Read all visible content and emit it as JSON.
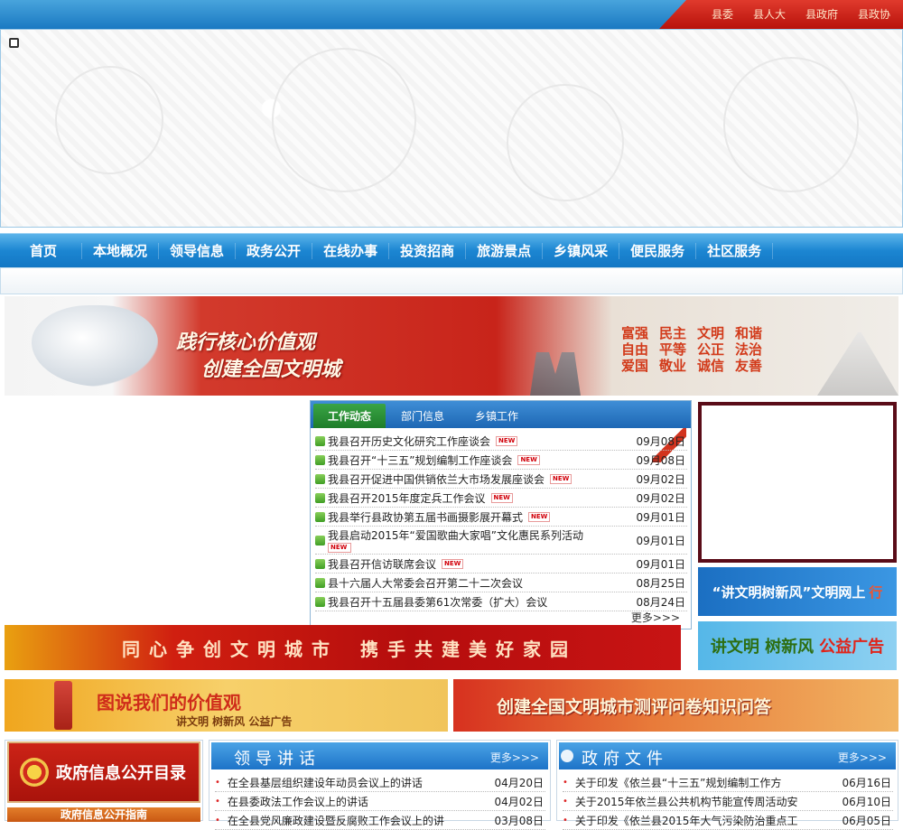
{
  "top_links": [
    "县委",
    "县人大",
    "县政府",
    "县政协"
  ],
  "nav": [
    "首页",
    "本地概况",
    "领导信息",
    "政务公开",
    "在线办事",
    "投资招商",
    "旅游景点",
    "乡镇风采",
    "便民服务",
    "社区服务"
  ],
  "red_banner": {
    "slogan_line1": "践行核心价值观",
    "slogan_line2": "创建全国文明城",
    "values": [
      "富强",
      "民主",
      "文明",
      "和谐",
      "自由",
      "平等",
      "公正",
      "法治",
      "爱国",
      "敬业",
      "诚信",
      "友善"
    ]
  },
  "news": {
    "tabs": [
      "工作动态",
      "部门信息",
      "乡镇工作"
    ],
    "new_tag": "NEW",
    "more": "更多>>>",
    "items": [
      {
        "title": "我县召开历史文化研究工作座谈会",
        "date": "09月08日"
      },
      {
        "title": "我县召开“十三五”规划编制工作座谈会",
        "date": "09月08日"
      },
      {
        "title": "我县召开促进中国供销依兰大市场发展座谈会",
        "date": "09月02日"
      },
      {
        "title": "我县召开2015年度定兵工作会议",
        "date": "09月02日"
      },
      {
        "title": "我县举行县政协第五届书画摄影展开幕式",
        "date": "09月01日"
      },
      {
        "title": "我县启动2015年“爱国歌曲大家唱”文化惠民系列活动",
        "date": "09月01日"
      },
      {
        "title": "我县召开信访联席会议",
        "date": "09月01日"
      },
      {
        "title": "县十六届人大常委会召开第二十二次会议",
        "date": "08月25日"
      },
      {
        "title": "我县召开十五届县委第61次常委（扩大）会议",
        "date": "08月24日"
      }
    ]
  },
  "promo1": {
    "main": "“讲文明树新风”文明网上",
    "accent": "行"
  },
  "promo2": {
    "main": "讲文明 树新风",
    "accent": "公益广告"
  },
  "strip": {
    "part1": "同心争创文明城市",
    "part2": "携手共建美好家园"
  },
  "orange1": {
    "big": "图说我们的价值观",
    "small": "讲文明 树新风 公益广告"
  },
  "orange2": {
    "big": "创建全国文明城市测评问卷知识问答"
  },
  "directory": {
    "title": "政府信息公开目录",
    "guide": "政府信息公开指南"
  },
  "leaders": {
    "title": "领导讲话",
    "more": "更多>>>",
    "items": [
      {
        "title": "在全县基层组织建设年动员会议上的讲话",
        "date": "04月20日"
      },
      {
        "title": "在县委政法工作会议上的讲话",
        "date": "04月02日"
      },
      {
        "title": "在全县党风廉政建设暨反腐败工作会议上的讲",
        "date": "03月08日"
      }
    ]
  },
  "docs": {
    "title": "政府文件",
    "more": "更多>>>",
    "items": [
      {
        "title": "关于印发《依兰县“十三五”规划编制工作方",
        "date": "06月16日"
      },
      {
        "title": "关于2015年依兰县公共机构节能宣传周活动安",
        "date": "06月10日"
      },
      {
        "title": "关于印发《依兰县2015年大气污染防治重点工",
        "date": "06月05日"
      }
    ]
  }
}
